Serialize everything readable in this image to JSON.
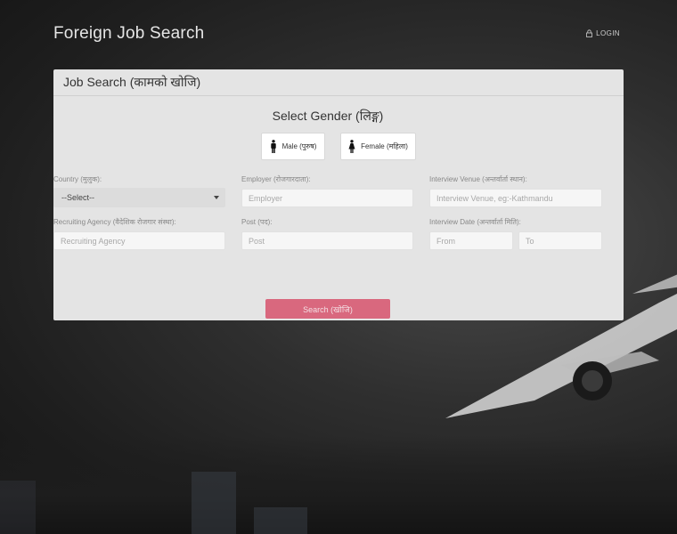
{
  "header": {
    "brand": "Foreign Job Search",
    "login_label": "LOGIN"
  },
  "panel": {
    "title": "Job Search (कामको खोजि)",
    "gender_title": "Select Gender (लिङ्ग)",
    "gender_options": [
      {
        "label": "Male (पुरुष)",
        "icon": "male-person-icon"
      },
      {
        "label": "Female (महिला)",
        "icon": "female-person-icon"
      }
    ],
    "fields": {
      "country": {
        "label": "Country (मुलुक):",
        "value": "--Select--"
      },
      "employer": {
        "label": "Employer (रोजगारदाता):",
        "placeholder": "Employer"
      },
      "venue": {
        "label": "Interview Venue (अन्तर्वार्ता स्थान):",
        "placeholder": "Interview Venue, eg:-Kathmandu"
      },
      "agency": {
        "label": "Recruiting Agency (वैदेशिक रोजगार संस्था):",
        "placeholder": "Recruiting Agency"
      },
      "post": {
        "label": "Post (पद):",
        "placeholder": "Post"
      },
      "date": {
        "label": "Interview Date (अन्तर्वार्ता मिति):",
        "from_placeholder": "From",
        "to_placeholder": "To"
      }
    },
    "search_label": "Search (खोजि)"
  },
  "colors": {
    "accent": "#d9687e",
    "panel_bg": "#e4e4e4"
  }
}
